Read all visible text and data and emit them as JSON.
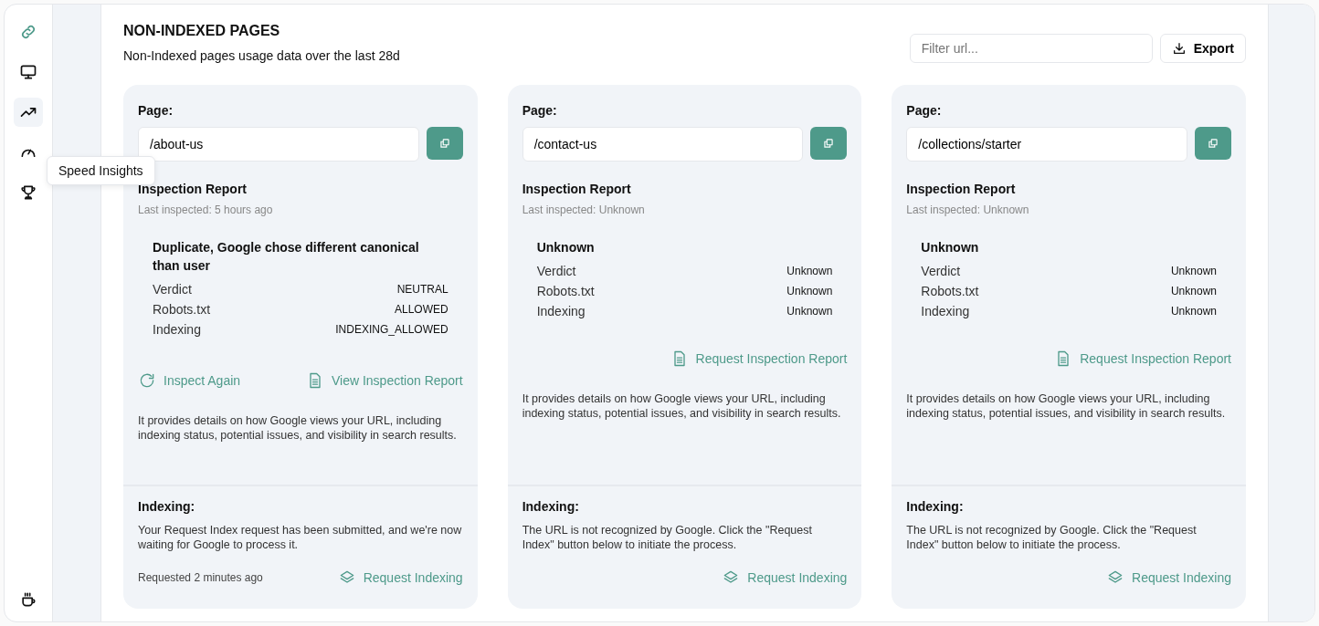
{
  "sidebar": {
    "items": [
      {
        "kind": "link",
        "selected": false
      },
      {
        "kind": "monitor",
        "selected": false
      },
      {
        "kind": "trend",
        "selected": true
      },
      {
        "kind": "gauge",
        "selected": false
      },
      {
        "kind": "trophy",
        "selected": false
      }
    ],
    "bottom_item": {
      "kind": "coffee"
    },
    "tooltip": "Speed Insights"
  },
  "header": {
    "title": "NON-INDEXED PAGES",
    "subtitle": "Non-Indexed pages usage data over the last 28d",
    "filter": {
      "placeholder": "Filter url..."
    },
    "export_button": "Export"
  },
  "cards": [
    {
      "page_label": "Page:",
      "url": "/about-us",
      "report_title": "Inspection Report",
      "last_inspected": "Last inspected: 5 hours ago",
      "status": "Duplicate, Google chose different canonical than user",
      "rows": [
        {
          "label": "Verdict",
          "value": "NEUTRAL"
        },
        {
          "label": "Robots.txt",
          "value": "ALLOWED"
        },
        {
          "label": "Indexing",
          "value": "INDEXING_ALLOWED"
        }
      ],
      "actions": [
        {
          "kind": "refresh",
          "label": "Inspect Again"
        },
        {
          "kind": "document",
          "label": "View Inspection Report"
        }
      ],
      "description": "It provides details on how Google views your URL, including indexing status, potential issues, and visibility in search results.",
      "indexing_title": "Indexing:",
      "indexing_text": "Your Request Index request has been submitted, and we're now waiting for Google to process it.",
      "requested": "Requested 2 minutes ago",
      "request_button": "Request Indexing"
    },
    {
      "page_label": "Page:",
      "url": "/contact-us",
      "report_title": "Inspection Report",
      "last_inspected": "Last inspected: Unknown",
      "status": "Unknown",
      "rows": [
        {
          "label": "Verdict",
          "value": "Unknown"
        },
        {
          "label": "Robots.txt",
          "value": "Unknown"
        },
        {
          "label": "Indexing",
          "value": "Unknown"
        }
      ],
      "actions": [
        {
          "kind": "document",
          "label": "Request Inspection Report"
        }
      ],
      "description": "It provides details on how Google views your URL, including indexing status, potential issues, and visibility in search results.",
      "indexing_title": "Indexing:",
      "indexing_text": "The URL is not recognized by Google. Click the \"Request Index\" button below to initiate the process.",
      "request_button": "Request Indexing"
    },
    {
      "page_label": "Page:",
      "url": "/collections/starter",
      "report_title": "Inspection Report",
      "last_inspected": "Last inspected: Unknown",
      "status": "Unknown",
      "rows": [
        {
          "label": "Verdict",
          "value": "Unknown"
        },
        {
          "label": "Robots.txt",
          "value": "Unknown"
        },
        {
          "label": "Indexing",
          "value": "Unknown"
        }
      ],
      "actions": [
        {
          "kind": "document",
          "label": "Request Inspection Report"
        }
      ],
      "description": "It provides details on how Google views your URL, including indexing status, potential issues, and visibility in search results.",
      "indexing_title": "Indexing:",
      "indexing_text": "The URL is not recognized by Google. Click the \"Request Index\" button below to initiate the process.",
      "request_button": "Request Indexing"
    }
  ]
}
